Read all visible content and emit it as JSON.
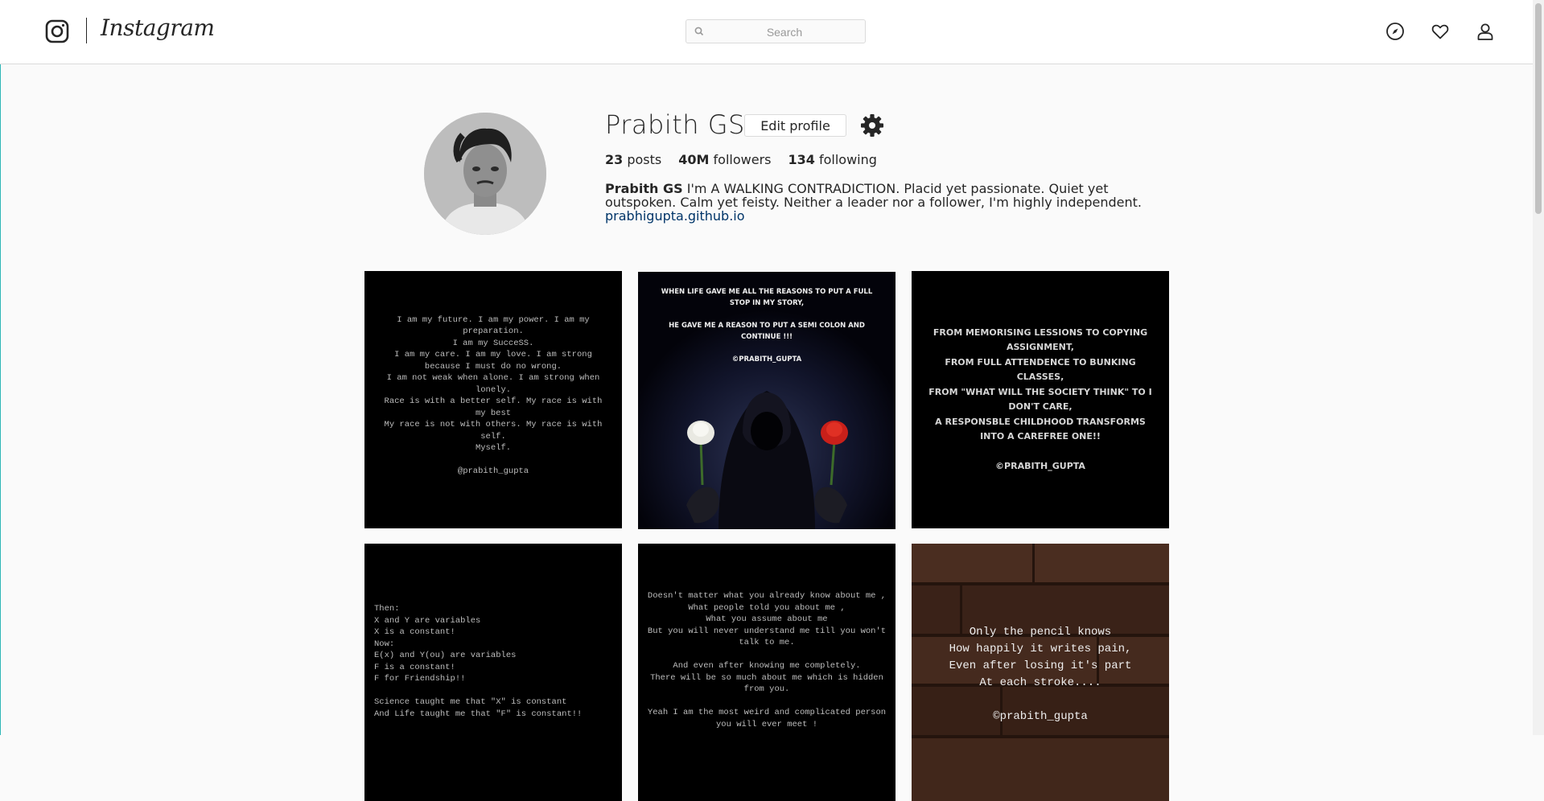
{
  "header": {
    "wordmark": "Instagram",
    "search_placeholder": "Search",
    "nav_icons": [
      "compass-icon",
      "heart-icon",
      "user-icon"
    ]
  },
  "profile": {
    "username": "Prabith GS",
    "edit_label": "Edit profile",
    "posts_count": "23",
    "posts_label": "posts",
    "followers_count": "40M",
    "followers_label": "followers",
    "following_count": "134",
    "following_label": "following",
    "bio_name": "Prabith GS",
    "bio_text": "I'm A WALKING CONTRADICTION. Placid yet passionate. Quiet yet outspoken. Calm yet feisty. Neither a leader nor a follower, I'm highly independent.",
    "link": "prabhigupta.github.io"
  },
  "posts": [
    {
      "text": "I am my future. I am my power. I am my preparation.\nI am my SucceSS.\nI am my care. I am my love. I am strong because I must do no wrong.\nI am not weak when alone. I am strong when lonely.\nRace is with a better self. My race is with my best\nMy race is not with others. My race is with self.\nMyself.\n\n@prabith_gupta"
    },
    {
      "text": "WHEN LIFE GAVE ME ALL THE REASONS TO PUT A FULL STOP IN MY STORY,\n\nHE GAVE ME A REASON TO PUT A SEMI COLON AND CONTINUE !!!\n\n©PRABITH_GUPTA"
    },
    {
      "text": "FROM MEMORISING LESSIONS TO COPYING ASSIGNMENT,\nFROM FULL ATTENDENCE TO BUNKING CLASSES,\nFROM \"WHAT WILL THE SOCIETY THINK\" TO I DON'T CARE,\nA RESPONSBLE CHILDHOOD TRANSFORMS INTO A CAREFREE ONE!!\n\n©PRABITH_GUPTA"
    },
    {
      "text": "Then:\nX and Y are variables\nX is a constant!\nNow:\nE(x) and Y(ou) are variables\nF is a constant!\nF for Friendship!!\n\nScience taught me that \"X\" is constant\nAnd Life taught me that \"F\" is constant!!"
    },
    {
      "text": "Doesn't matter what you already know about me ,\nWhat people told you about me ,\nWhat you assume about me\nBut you will never understand me till you won't talk to me.\n\nAnd even after knowing me completely.\nThere will be so much about me which is hidden from you.\n\nYeah I am the most weird and complicated person you will ever meet !"
    },
    {
      "text": "Only the pencil knows\nHow happily it writes pain,\nEven after losing it's part\nAt each stroke....\n\n©prabith_gupta"
    }
  ],
  "colors": {
    "accent_link": "#003569",
    "border": "#dbdbdb",
    "background": "#fafafa"
  }
}
